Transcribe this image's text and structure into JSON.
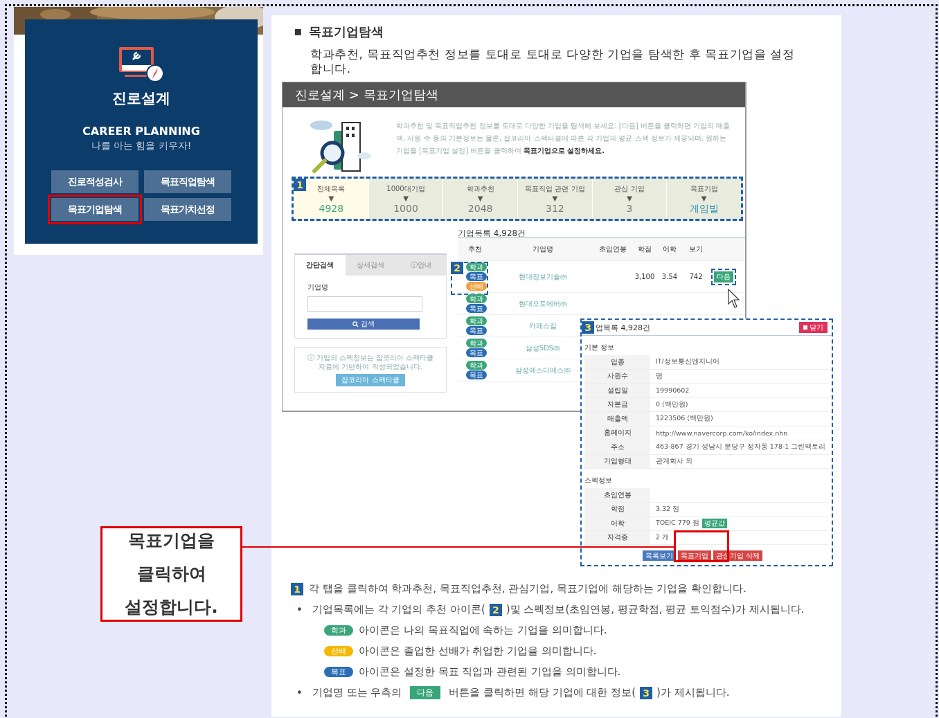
{
  "sidebar_card": {
    "title": "진로설계",
    "subtitle": "CAREER PLANNING",
    "slogan": "나를 아는 힘을 키우자!",
    "buttons": [
      {
        "label": "진로적성검사",
        "highlighted": false
      },
      {
        "label": "목표직업탐색",
        "highlighted": false
      },
      {
        "label": "목표기업탐색",
        "highlighted": true
      },
      {
        "label": "목표가치선정",
        "highlighted": false
      }
    ]
  },
  "callout": {
    "text": "목표기업을 클릭하여 설정합니다."
  },
  "section": {
    "bullet": "▪",
    "heading": "목표기업탐색",
    "intro": "학과추천, 목표직업추천 정보를 토대로 토대로 다양한 기업을 탐색한 후 목표기업을 설정합니다."
  },
  "screenshot": {
    "breadcrumb": "진로설계 > 목표기업탐색",
    "description": "학과추천 및 목표직업추천 정보를 토대로 다양한 기업을 탐색해 보세요. [다음] 버튼을 클릭하면 기업의 매출액, 사원 수 등의 기본정보는 물론, 잡코리아 스펙타클에 따른 각 기업의 평균 스펙 정보가 제공되며, 원하는 기업을 [목표기업 설정] 버튼을 클릭하여",
    "description_bold": "목표기업으로 설정하세요.",
    "marker_1": "1",
    "stats": [
      {
        "label": "전체목록",
        "arrow": "▼",
        "value": "4928",
        "selected": true,
        "color": "#3aa57a"
      },
      {
        "label": "1000대기업",
        "arrow": "▼",
        "value": "1000",
        "selected": false,
        "color": "#777777"
      },
      {
        "label": "학과추천",
        "arrow": "▼",
        "value": "2048",
        "selected": false,
        "color": "#777777"
      },
      {
        "label": "목표직업 관련 기업",
        "arrow": "▼",
        "value": "312",
        "selected": false,
        "color": "#777777"
      },
      {
        "label": "관심 기업",
        "arrow": "▼",
        "value": "3",
        "selected": false,
        "color": "#777777"
      },
      {
        "label": "목표기업",
        "arrow": "▼",
        "value": "게임빌",
        "selected": false,
        "color": "#2a8fb8"
      }
    ],
    "list_title": "기업목록 4,928건",
    "search_tabs": [
      {
        "label": "간단검색",
        "selected": true
      },
      {
        "label": "상세검색",
        "selected": false
      },
      {
        "label": "ⓘ안내",
        "selected": false
      }
    ],
    "field_label": "기업명",
    "search_button": "검색",
    "notice": "ⓘ 기업의 스펙정보는 잡코리아 스펙타클 자료에 기반하여 작성되었습니다.",
    "notice_button": "잡코리아 스펙타클",
    "columns": [
      "추천",
      "기업명",
      "초임연봉",
      "학점",
      "어학",
      "보기"
    ],
    "marker_2": "2",
    "rows": [
      {
        "tags": [
          {
            "label": "학과",
            "color": "#3aa57a"
          },
          {
            "label": "목표",
            "color": "#2a6db5"
          },
          {
            "label": "선배",
            "color": "#f0a040"
          }
        ],
        "company": "현대정보기술㈜",
        "salary": "3,100",
        "gpa": "3.54",
        "lang": "742",
        "action": "다음"
      },
      {
        "tags": [
          {
            "label": "학과",
            "color": "#3aa57a"
          },
          {
            "label": "목표",
            "color": "#2a6db5"
          }
        ],
        "company": "현대오토에버㈜"
      },
      {
        "tags": [
          {
            "label": "학과",
            "color": "#3aa57a"
          },
          {
            "label": "목표",
            "color": "#2a6db5"
          }
        ],
        "company": "카페스킬"
      },
      {
        "tags": [
          {
            "label": "학과",
            "color": "#3aa57a"
          },
          {
            "label": "목표",
            "color": "#2a6db5"
          }
        ],
        "company": "삼성SDS㈜"
      },
      {
        "tags": [
          {
            "label": "학과",
            "color": "#3aa57a"
          },
          {
            "label": "목표",
            "color": "#2a6db5"
          }
        ],
        "company": "삼성에스디에스㈜"
      }
    ]
  },
  "detail_popup": {
    "marker": "3",
    "title": "업목록 4,928건",
    "close": "닫기",
    "basic_heading": "기본 정보",
    "basic": [
      {
        "label": "업종",
        "value": "IT/정보통신엔지니어"
      },
      {
        "label": "사원수",
        "value": "명"
      },
      {
        "label": "설립일",
        "value": "19990602"
      },
      {
        "label": "자본금",
        "value": "0 (백만원)"
      },
      {
        "label": "매출액",
        "value": "1223506 (백만원)"
      },
      {
        "label": "홈페이지",
        "value": "http://www.navercorp.com/ko/index.nhn"
      },
      {
        "label": "주소",
        "value": "463-867 경기 성남시 분당구 정자동 178-1 그린팩토리"
      },
      {
        "label": "기업형태",
        "value": "관계회사 외"
      }
    ],
    "spec_heading": "스펙정보",
    "spec": [
      {
        "label": "초임연봉"
      },
      {
        "label": "학점",
        "value": "3.32 점"
      },
      {
        "label": "어학",
        "value": "TOEIC 779 점",
        "badge": "평균값"
      },
      {
        "label": "자격증",
        "value": "2 개"
      }
    ],
    "buttons": [
      {
        "label": "목록보기",
        "color": "#4a78c0"
      },
      {
        "label": "목표기업",
        "color": "#d64545"
      },
      {
        "label": "관심기업 삭제",
        "color": "#d64545"
      }
    ]
  },
  "notes": [
    {
      "kind": "numbered",
      "parts": [
        {
          "kind": "marker",
          "text": "1"
        },
        {
          "kind": "text",
          "text": "각 탭을 클릭하여 학과추천, 목표직업추천, 관심기업, 목표기업에 해당하는 기업을 확인합니다."
        }
      ]
    },
    {
      "kind": "bullet",
      "bullet": "•",
      "parts": [
        {
          "kind": "text",
          "text": "기업목록에는 각 기업의 추천 아이콘("
        },
        {
          "kind": "marker",
          "text": "2"
        },
        {
          "kind": "text",
          "text": ")및 스펙정보(초임연봉, 평균학점, 평균 토익점수)가 제시됩니다."
        }
      ]
    },
    {
      "kind": "tag",
      "parts": [
        {
          "kind": "tag",
          "text": "학과",
          "color": "#3aa57a"
        },
        {
          "kind": "text",
          "text": "아이콘은 나의 목표직업에 속하는 기업을 의미합니다."
        }
      ]
    },
    {
      "kind": "tag",
      "parts": [
        {
          "kind": "tag",
          "text": "선배",
          "color": "#f5b800"
        },
        {
          "kind": "text",
          "text": "아이콘은 졸업한 선배가 취업한 기업을 의미합니다."
        }
      ]
    },
    {
      "kind": "tag",
      "parts": [
        {
          "kind": "tag",
          "text": "목표",
          "color": "#2a6db5"
        },
        {
          "kind": "text",
          "text": "아이콘은 설정한 목표 직업과 관련된 기업을 의미합니다."
        }
      ]
    },
    {
      "kind": "bullet",
      "bullet": "•",
      "parts": [
        {
          "kind": "text",
          "text": "기업명 또는 우측의"
        },
        {
          "kind": "button",
          "text": "다음"
        },
        {
          "kind": "text",
          "text": "버튼을 클릭하면 해당 기업에 대한 정보("
        },
        {
          "kind": "marker",
          "text": "3"
        },
        {
          "kind": "text",
          "text": ")가 제시됩니다."
        }
      ]
    }
  ]
}
